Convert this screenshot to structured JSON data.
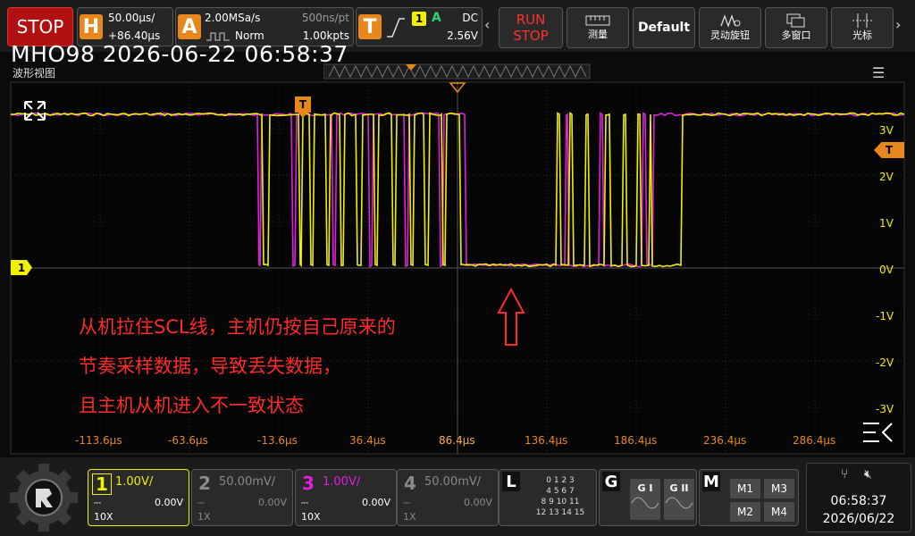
{
  "top": {
    "stop": "STOP",
    "h_badge": "H",
    "h_timebase": "50.00μs/",
    "h_offset": "+86.40μs",
    "a_badge": "A",
    "a_rate": "2.00MSa/s",
    "a_mode": "Norm",
    "a_nspt": "500ns/pt",
    "a_kpts": "1.00kpts",
    "t_badge": "T",
    "t_ch": "1",
    "t_a": "A",
    "t_coupling": "DC",
    "t_level": "2.56V",
    "run": "RUN",
    "run_stop": "STOP",
    "measure": "测量",
    "default": "Default",
    "knob": "灵动旋钮",
    "multiwin": "多窗口",
    "cursor": "光标"
  },
  "screen": {
    "title": "MHO98 2026-06-22 06:58:37",
    "view_label": "波形视图",
    "annotation": [
      "从机拉住SCL线，主机仍按自己原来的",
      "节奏采样数据，导致丢失数据，",
      "且主机从机进入不一致状态"
    ],
    "trigger_marker": "T",
    "ch1_marker": "1",
    "right_trigger_marker": "T",
    "y_labels": [
      "3V",
      "2V",
      "1V",
      "0V",
      "-1V",
      "-2V",
      "-3V"
    ],
    "x_labels": [
      "-113.6μs",
      "-63.6μs",
      "-13.6μs",
      "36.4μs",
      "86.4μs",
      "136.4μs",
      "186.4μs",
      "236.4μs",
      "286.4μs"
    ]
  },
  "channels": [
    {
      "num": "1",
      "scale": "1.00V/",
      "offset": "0.00V",
      "probe": "10X",
      "color": "#f0f000",
      "active": true
    },
    {
      "num": "2",
      "scale": "50.00mV/",
      "offset": "0.00V",
      "probe": "1X",
      "color": "#8a8a8a",
      "active": false
    },
    {
      "num": "3",
      "scale": "1.00V/",
      "offset": "0.00V",
      "probe": "10X",
      "color": "#e020e0",
      "active": true
    },
    {
      "num": "4",
      "scale": "50.00mV/",
      "offset": "0.00V",
      "probe": "1X",
      "color": "#8a8a8a",
      "active": false
    }
  ],
  "bottom": {
    "l_label": "L",
    "l_rows": [
      "0 1 2 3",
      "4 5 6 7",
      "8 9 10 11",
      "12 13 14 15"
    ],
    "g_label": "G",
    "g1": "G I",
    "g2": "G II",
    "m_label": "M",
    "m1": "M1",
    "m2": "M2",
    "m3": "M3",
    "m4": "M4",
    "time": "06:58:37",
    "date": "2026/06/22"
  },
  "colors": {
    "ch1": "#f0f000",
    "ch3": "#e020e0",
    "accent": "#e8881c",
    "annotation": "#ff2a2a"
  }
}
